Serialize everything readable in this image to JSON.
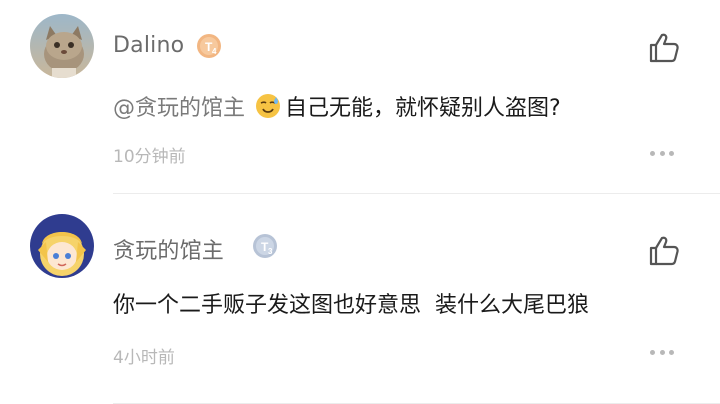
{
  "comments": [
    {
      "username": "Dalino",
      "level_icon": "level-4-badge-icon",
      "mention": "@贪玩的馆主",
      "emoji_icon": "sweat-smile-emoji-icon",
      "text": "自己无能，就怀疑别人盗图?",
      "timestamp": "10分钟前"
    },
    {
      "username": "贪玩的馆主",
      "level_icon": "level-3-badge-icon",
      "text": "你一个二手贩子发这图也好意思  装什么大尾巴狼",
      "timestamp": "4小时前"
    }
  ],
  "colors": {
    "username": "#6b6b6b",
    "content": "#1a1a1a",
    "mention": "#7a7a7a",
    "meta": "#b8b8b8",
    "level4_badge": "#f0b27a",
    "level3_badge": "#b7c3d6",
    "divider": "#ececec"
  }
}
